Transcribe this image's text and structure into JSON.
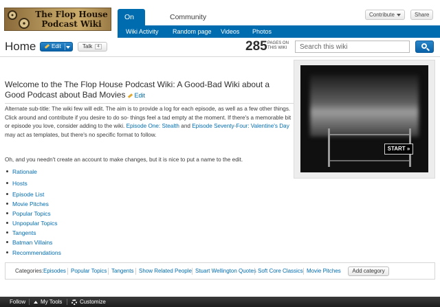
{
  "header": {
    "wordmark_text": "The Flop House Podcast Wiki",
    "tabs": [
      {
        "label": "On the Wiki"
      },
      {
        "label": "Community"
      }
    ],
    "subnav": [
      {
        "label": "Wiki Activity"
      },
      {
        "label": "Random page"
      },
      {
        "label": "Videos"
      },
      {
        "label": "Photos"
      }
    ],
    "contribute_label": "Contribute",
    "share_label": "Share"
  },
  "page": {
    "title": "Home",
    "edit_label": "Edit",
    "talk_label": "Talk",
    "talk_count": "4",
    "pages_count": "285",
    "pages_label": "PAGES ON THIS WIKI",
    "search_placeholder": "Search this wiki"
  },
  "article": {
    "heading": "Welcome to the The Flop House Podcast Wiki: A Good-Bad Wiki about a Good Podcast about Bad Movies",
    "heading_edit": "Edit",
    "intro_1": "Alternate sub-title: The wiki few will edit. The aim is to provide a log for each episode, as well as a few other things. Click around and contribute if you desire to do so- things feel a tad empty at the moment. If there's a memorable bit or episode you love, consider adding to the wiki. ",
    "link_1": "Episode One: Stealth",
    "intro_and": " and ",
    "link_2": "Episode Seventy-Four: Valentine's Day",
    "intro_2": " may act as templates, but there's no specific format to follow.",
    "note": "Oh, and you needn't create an account to make changes, but it is nice to put a name to the edit.",
    "toc": [
      {
        "label": "Rationale"
      },
      {
        "label": "Hosts"
      },
      {
        "label": "Episode List"
      },
      {
        "label": "Movie Pitches"
      },
      {
        "label": "Popular Topics"
      },
      {
        "label": "Unpopular Topics"
      },
      {
        "label": "Tangents"
      },
      {
        "label": "Batman Villains"
      },
      {
        "label": "Recommendations"
      }
    ]
  },
  "ad": {
    "start_label": "START »"
  },
  "categories": {
    "label": "Categories:",
    "items": [
      {
        "label": "Episodes"
      },
      {
        "label": "Popular Topics"
      },
      {
        "label": "Tangents"
      },
      {
        "label": "Show Related People"
      },
      {
        "label": "Stuart Wellington Quotes"
      },
      {
        "label": "Soft Core Classics"
      },
      {
        "label": "Movie Pitches"
      }
    ],
    "add_label": "Add category"
  },
  "toolbar": {
    "follow_label": "Follow",
    "mytools_label": "My Tools",
    "customize_label": "Customize"
  },
  "colors": {
    "accent": "#006cb0",
    "link": "#006cb0",
    "toolbar": "#2a2a2a"
  }
}
